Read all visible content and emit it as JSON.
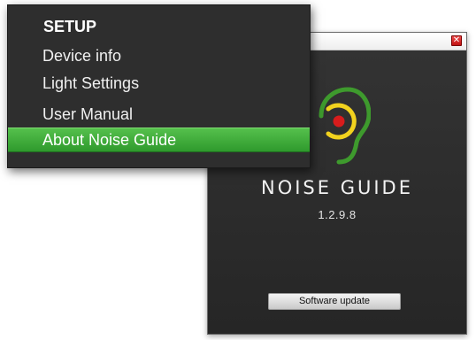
{
  "about_window": {
    "close_label": "✕",
    "app_name": "NOISE GUIDE",
    "version": "1.2.9.8",
    "update_button_label": "Software update",
    "logo_icon": "ear-sensor-icon"
  },
  "setup_menu": {
    "heading": "SETUP",
    "items": [
      {
        "label": "Device info"
      },
      {
        "label": "Light Settings"
      },
      {
        "label": "User Manual"
      },
      {
        "label": "About Noise Guide",
        "selected": true
      }
    ]
  },
  "colors": {
    "menu_selection": "#3fae3a",
    "logo_green": "#3e9a2d",
    "logo_yellow": "#f2d21e",
    "logo_red": "#d81c1c",
    "close_red": "#d32a2a"
  }
}
